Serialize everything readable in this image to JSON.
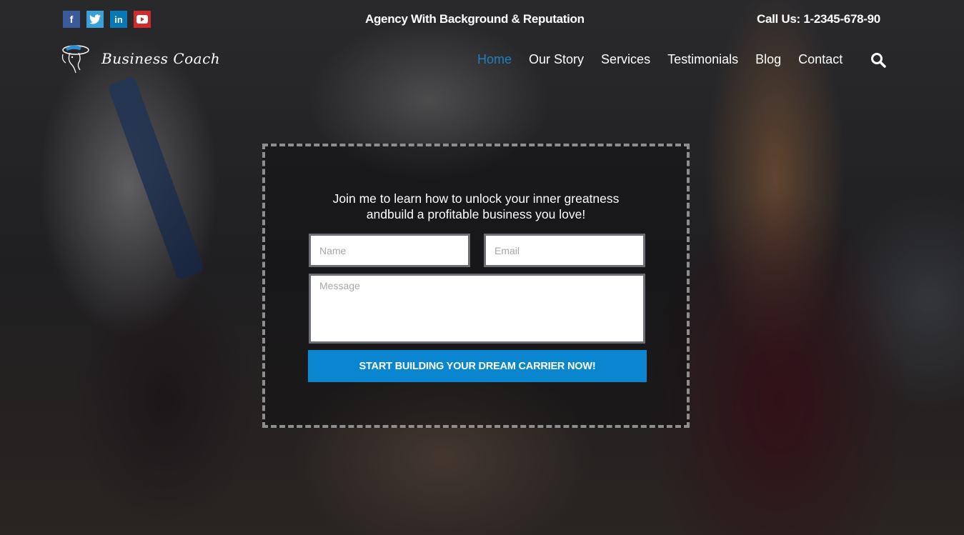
{
  "topbar": {
    "social": [
      {
        "name": "facebook",
        "glyph": "f",
        "color": "#3b5a9a"
      },
      {
        "name": "twitter",
        "glyph": "🐦",
        "color": "#3aa0dc"
      },
      {
        "name": "linkedin",
        "glyph": "in",
        "color": "#0a78b4"
      },
      {
        "name": "youtube",
        "glyph": "▶",
        "color": "#d02a2a"
      }
    ],
    "tagline": "Agency With Background & Reputation",
    "phone": "Call Us: 1-2345-678-90"
  },
  "logo": {
    "text": "Business Coach"
  },
  "nav": {
    "items": [
      {
        "label": "Home",
        "active": true
      },
      {
        "label": "Our Story",
        "active": false
      },
      {
        "label": "Services",
        "active": false
      },
      {
        "label": "Testimonials",
        "active": false
      },
      {
        "label": "Blog",
        "active": false
      },
      {
        "label": "Contact",
        "active": false
      }
    ],
    "search_icon": "search-icon",
    "accent_color": "#1f7fbf"
  },
  "form": {
    "headline_line1": "Join me to learn how to unlock your inner greatness",
    "headline_line2": "andbuild a profitable business you love!",
    "name_placeholder": "Name",
    "email_placeholder": "Email",
    "message_placeholder": "Message",
    "name_value": "",
    "email_value": "",
    "message_value": "",
    "submit_label": "START BUILDING YOUR DREAM CARRIER NOW!",
    "submit_color": "#0a86d0"
  }
}
